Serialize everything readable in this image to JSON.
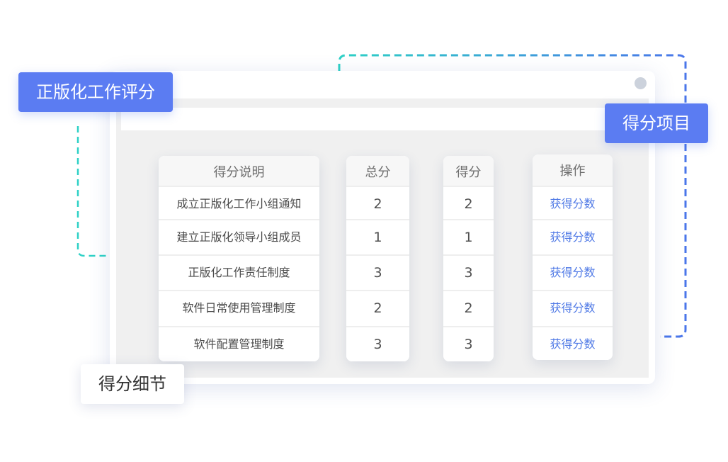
{
  "labels": {
    "top_left": "正版化工作评分",
    "right": "得分项目",
    "bottom_left": "得分细节"
  },
  "table": {
    "headers": {
      "description": "得分说明",
      "total": "总分",
      "score": "得分",
      "action": "操作"
    },
    "rows": [
      {
        "description": "成立正版化工作小组通知",
        "total": "2",
        "score": "2",
        "action": "获得分数"
      },
      {
        "description": "建立正版化领导小组成员",
        "total": "1",
        "score": "1",
        "action": "获得分数"
      },
      {
        "description": "正版化工作责任制度",
        "total": "3",
        "score": "3",
        "action": "获得分数"
      },
      {
        "description": "软件日常使用管理制度",
        "total": "2",
        "score": "2",
        "action": "获得分数"
      },
      {
        "description": "软件配置管理制度",
        "total": "3",
        "score": "3",
        "action": "获得分数"
      }
    ]
  },
  "colors": {
    "accent_blue": "#5b7cf2",
    "link_blue": "#4f79e6",
    "teal": "#2ed1c6",
    "dashed_blue": "#4a76ea"
  }
}
